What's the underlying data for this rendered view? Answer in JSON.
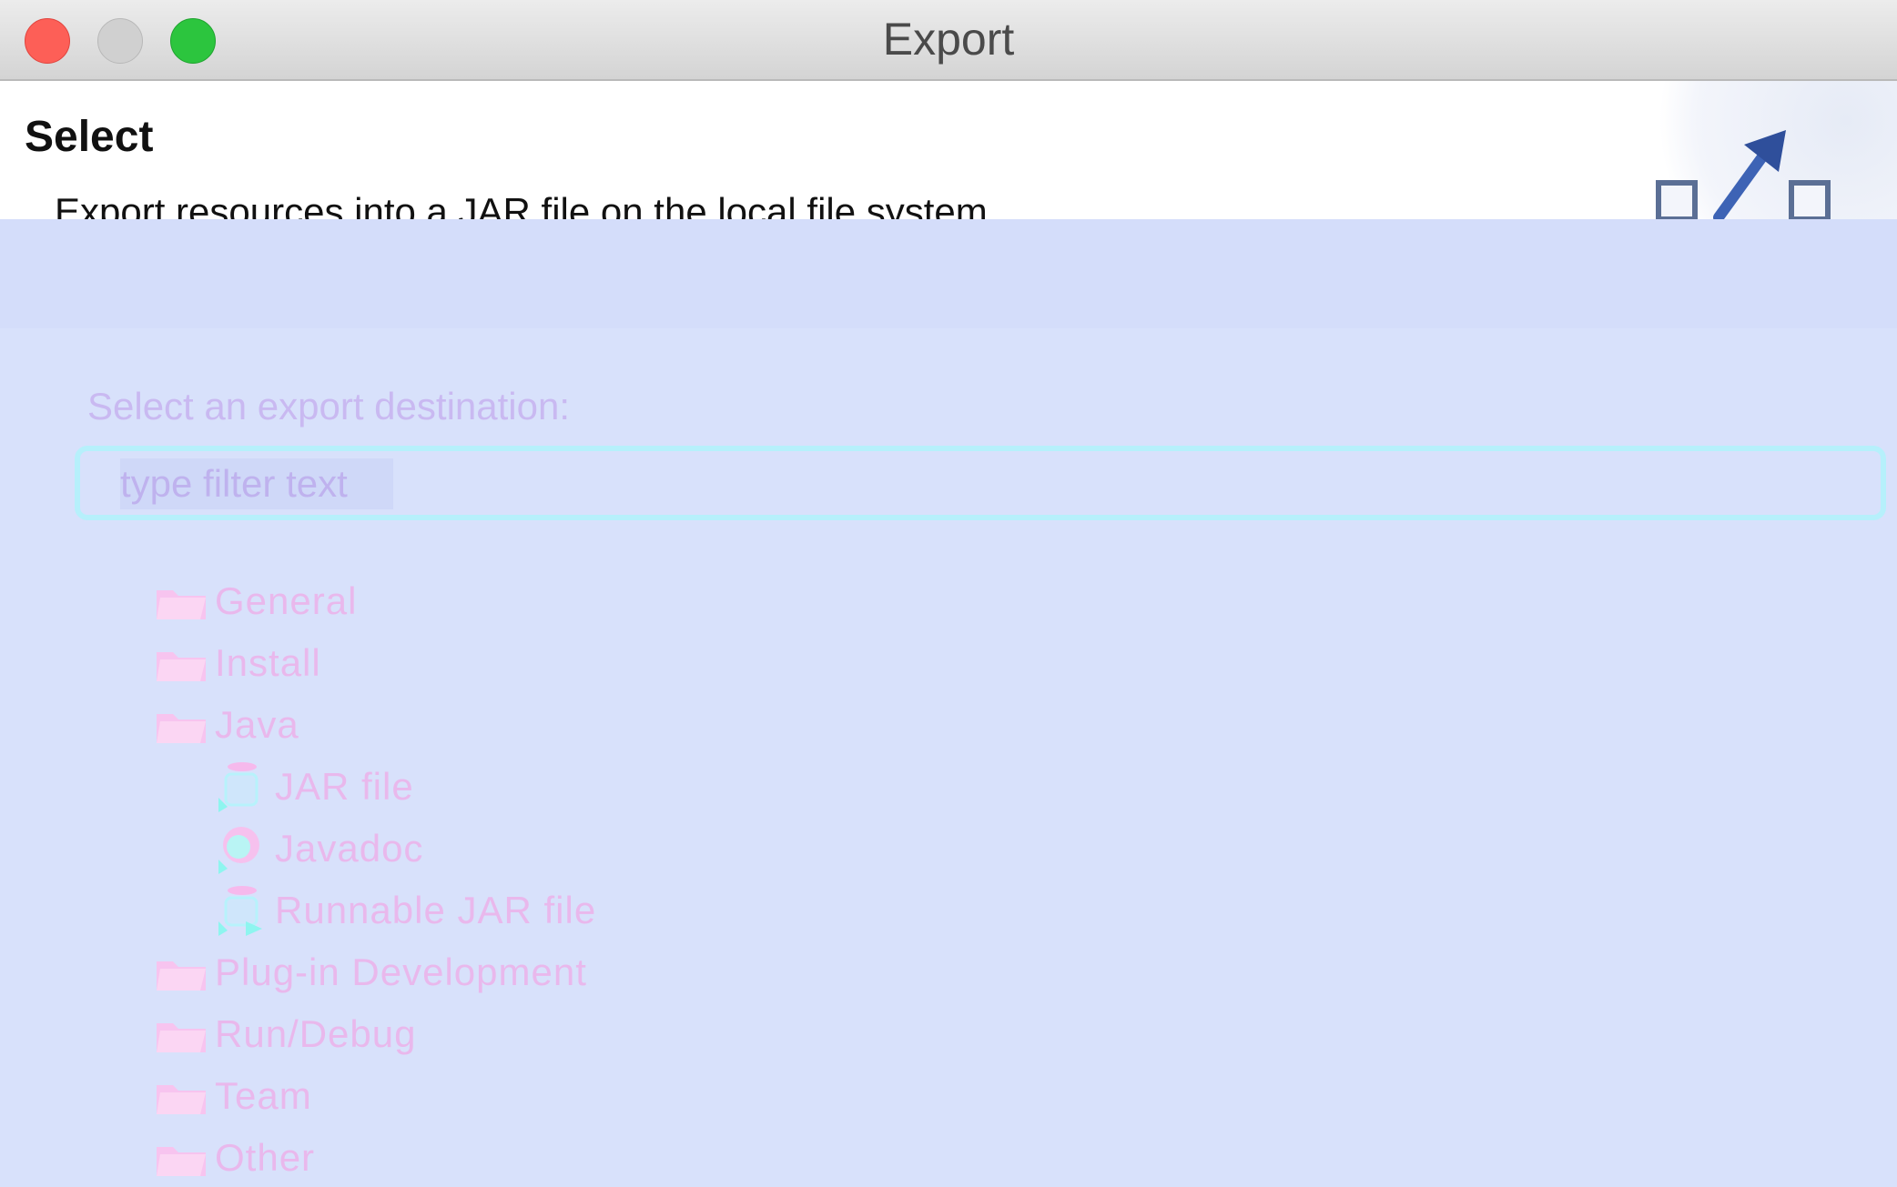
{
  "window": {
    "title": "Export"
  },
  "header": {
    "heading": "Select",
    "description": "Export resources into a JAR file on the local file system."
  },
  "main": {
    "destination_label": "Select an export destination:",
    "filter_placeholder": "type filter text",
    "tree": [
      {
        "label": "General",
        "icon": "folder-icon",
        "level": 0
      },
      {
        "label": "Install",
        "icon": "folder-icon",
        "level": 0
      },
      {
        "label": "Java",
        "icon": "folder-icon",
        "level": 0
      },
      {
        "label": "JAR file",
        "icon": "jar-icon",
        "level": 1
      },
      {
        "label": "Javadoc",
        "icon": "javadoc-icon",
        "level": 1
      },
      {
        "label": "Runnable JAR file",
        "icon": "runnable-jar-icon",
        "level": 1
      },
      {
        "label": "Plug-in Development",
        "icon": "folder-icon",
        "level": 0
      },
      {
        "label": "Run/Debug",
        "icon": "folder-icon",
        "level": 0
      },
      {
        "label": "Team",
        "icon": "folder-icon",
        "level": 0
      },
      {
        "label": "Other",
        "icon": "folder-icon",
        "level": 0
      }
    ]
  },
  "colors": {
    "background": "#d8e1fb",
    "label_text": "#e9b8ec",
    "filter_border": "#b6f0fb"
  }
}
